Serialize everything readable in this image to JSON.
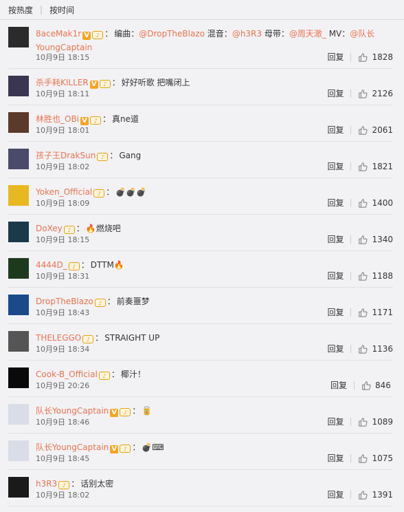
{
  "sort": {
    "hot": "按热度",
    "time": "按时间"
  },
  "reply_label": "回复",
  "comments": [
    {
      "user": "8aceMak1r",
      "verified": true,
      "text_segments": [
        {
          "t": "编曲：",
          "m": false
        },
        {
          "t": "@DropTheBlazo",
          "m": true
        },
        {
          "t": " 混音：",
          "m": false
        },
        {
          "t": "@h3R3",
          "m": true
        },
        {
          "t": " 母带：",
          "m": false
        },
        {
          "t": "@周天澈_",
          "m": true
        },
        {
          "t": " MV：",
          "m": false
        },
        {
          "t": "@队长YoungCaptain",
          "m": true
        }
      ],
      "time": "10月9日 18:15",
      "likes": "1828",
      "avatar_color": "#2b2b2b"
    },
    {
      "user": "杀手耗KILLER",
      "verified": true,
      "text_segments": [
        {
          "t": "好好听歌 把嘴闭上",
          "m": false
        }
      ],
      "time": "10月9日 18:11",
      "likes": "2126",
      "avatar_color": "#3a3550"
    },
    {
      "user": "林胜也_OBi",
      "verified": true,
      "text_segments": [
        {
          "t": "真ne道",
          "m": false
        }
      ],
      "time": "10月9日 18:01",
      "likes": "2061",
      "avatar_color": "#5a3a2a"
    },
    {
      "user": "孩子王DrakSun",
      "verified": false,
      "text_segments": [
        {
          "t": "Gang",
          "m": false
        }
      ],
      "time": "10月9日 18:02",
      "likes": "1821",
      "avatar_color": "#4a4a6a"
    },
    {
      "user": "Yoken_Official",
      "verified": false,
      "text_segments": [
        {
          "t": "💣💣💣",
          "m": false
        }
      ],
      "time": "10月9日 18:09",
      "likes": "1400",
      "avatar_color": "#e8b820"
    },
    {
      "user": "DoXey",
      "verified": false,
      "text_segments": [
        {
          "t": "🔥燃烧吧",
          "m": false
        }
      ],
      "time": "10月9日 18:15",
      "likes": "1340",
      "avatar_color": "#1a3a4a"
    },
    {
      "user": "4444D_",
      "verified": false,
      "text_segments": [
        {
          "t": "DTTM🔥",
          "m": false
        }
      ],
      "time": "10月9日 18:31",
      "likes": "1188",
      "avatar_color": "#1e3a1e"
    },
    {
      "user": "DropTheBlazo",
      "verified": false,
      "text_segments": [
        {
          "t": "前奏噩梦",
          "m": false
        }
      ],
      "time": "10月9日 18:43",
      "likes": "1171",
      "avatar_color": "#1a4a8a"
    },
    {
      "user": "THELEGGO",
      "verified": false,
      "text_segments": [
        {
          "t": "STRAIGHT UP",
          "m": false
        }
      ],
      "time": "10月9日 18:34",
      "likes": "1136",
      "avatar_color": "#555555"
    },
    {
      "user": "Cook-B_Official",
      "verified": false,
      "text_segments": [
        {
          "t": "椰汁！",
          "m": false
        }
      ],
      "time": "10月9日 20:26",
      "likes": "846",
      "avatar_color": "#0a0a0a"
    },
    {
      "user": "队长YoungCaptain",
      "verified": true,
      "text_segments": [
        {
          "t": "🥫",
          "m": false
        }
      ],
      "time": "10月9日 18:46",
      "likes": "1089",
      "avatar_color": "#d9dde8"
    },
    {
      "user": "队长YoungCaptain",
      "verified": true,
      "text_segments": [
        {
          "t": "💣⌨",
          "m": false
        }
      ],
      "time": "10月9日 18:45",
      "likes": "1075",
      "avatar_color": "#d9dde8"
    },
    {
      "user": "h3R3",
      "verified": false,
      "text_segments": [
        {
          "t": "话别太密",
          "m": false
        }
      ],
      "time": "10月9日 18:02",
      "likes": "1391",
      "avatar_color": "#1a1a1a"
    }
  ]
}
